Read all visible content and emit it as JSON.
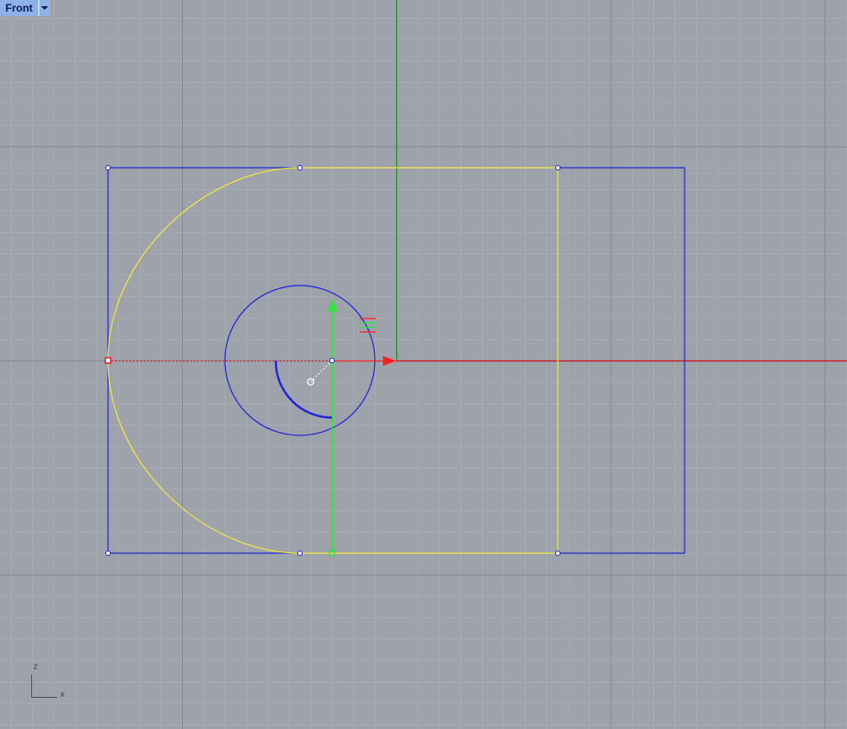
{
  "viewport": {
    "name": "Front",
    "tab_menu_icon": "dropdown-arrow-icon"
  },
  "axis_indicator": {
    "vertical_label": "z",
    "horizontal_label": "x"
  },
  "colors": {
    "background": "#9ea3ab",
    "grid_minor": "#a6abb2",
    "grid_major": "#878b91",
    "x_axis": "#d01010",
    "z_axis": "#1f8a2a",
    "selected_curve": "#f2e640",
    "curve": "#1f26d6",
    "gumball_x": "#ff2020",
    "gumball_z": "#2ee63a",
    "tab_background": "#8fb1ea"
  }
}
